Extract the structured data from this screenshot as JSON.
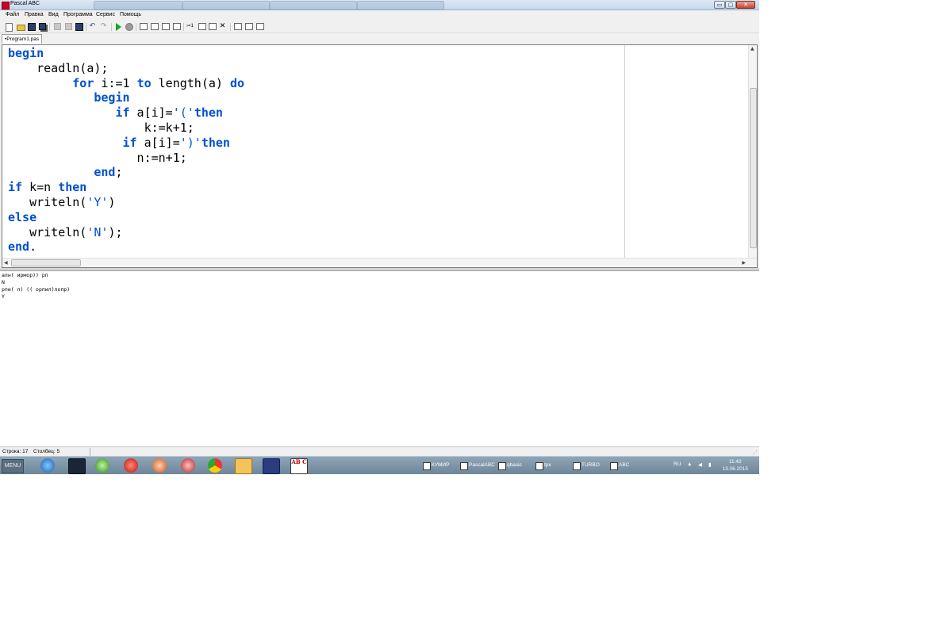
{
  "window": {
    "title": "Pascal ABC",
    "minimize": "▭",
    "maximize": "▢",
    "close": "✕"
  },
  "menu": [
    "Файл",
    "Правка",
    "Вид",
    "Программа",
    "Сервис",
    "Помощь"
  ],
  "toolbar": {
    "icons": [
      "new-file-icon",
      "open-folder-icon",
      "save-icon",
      "save-all-icon",
      "cut-icon",
      "copy-icon",
      "paste-icon",
      "undo-icon",
      "redo-icon",
      "run-icon",
      "stop-icon",
      "step-into-icon",
      "step-over-icon",
      "step-out-icon",
      "watch-icon",
      "tab-settings-icon",
      "window-icon",
      "compare-icon",
      "close-x-icon",
      "layout-icon",
      "layout2-icon",
      "layout3-icon"
    ],
    "undo": "↶",
    "redo": "↷",
    "step_text": "›=1",
    "close_x": "✕"
  },
  "editor_tab": "•Program1.pas",
  "code": [
    [
      {
        "t": "kw",
        "v": "begin"
      }
    ],
    [
      {
        "t": "p",
        "v": "    readln(a);"
      }
    ],
    [
      {
        "t": "p",
        "v": "         "
      },
      {
        "t": "kw",
        "v": "for"
      },
      {
        "t": "p",
        "v": " i:=1 "
      },
      {
        "t": "kw",
        "v": "to"
      },
      {
        "t": "p",
        "v": " length(a) "
      },
      {
        "t": "kw",
        "v": "do"
      }
    ],
    [
      {
        "t": "p",
        "v": "            "
      },
      {
        "t": "kw",
        "v": "begin"
      }
    ],
    [
      {
        "t": "p",
        "v": "               "
      },
      {
        "t": "kw",
        "v": "if"
      },
      {
        "t": "p",
        "v": " a[i]="
      },
      {
        "t": "str",
        "v": "'('"
      },
      {
        "t": "kw",
        "v": "then"
      }
    ],
    [
      {
        "t": "p",
        "v": "                   k:=k+1;"
      }
    ],
    [
      {
        "t": "p",
        "v": "                "
      },
      {
        "t": "kw",
        "v": "if"
      },
      {
        "t": "p",
        "v": " a[i]="
      },
      {
        "t": "str",
        "v": "')'"
      },
      {
        "t": "kw",
        "v": "then"
      }
    ],
    [
      {
        "t": "p",
        "v": "                  n:=n+1;"
      }
    ],
    [
      {
        "t": "p",
        "v": "            "
      },
      {
        "t": "kw",
        "v": "end"
      },
      {
        "t": "p",
        "v": ";"
      }
    ],
    [
      {
        "t": "kw",
        "v": "if"
      },
      {
        "t": "p",
        "v": " k=n "
      },
      {
        "t": "kw",
        "v": "then"
      }
    ],
    [
      {
        "t": "p",
        "v": "   writeln("
      },
      {
        "t": "str",
        "v": "'Y'"
      },
      {
        "t": "p",
        "v": ")"
      }
    ],
    [
      {
        "t": "kw",
        "v": "else"
      }
    ],
    [
      {
        "t": "p",
        "v": "   writeln("
      },
      {
        "t": "str",
        "v": "'N'"
      },
      {
        "t": "p",
        "v": ");"
      }
    ],
    [
      {
        "t": "kw",
        "v": "end"
      },
      {
        "t": "p",
        "v": "."
      }
    ]
  ],
  "colors": {
    "keyword": "#0050d0",
    "plain": "#000000"
  },
  "output_lines": [
    "алн( ирмор)) рп",
    "N",
    "рпи( л) (( орпил)лопр)",
    "Y"
  ],
  "status": {
    "line": "Строка: 17",
    "column": "Столбец: 5"
  },
  "taskbar": {
    "start": "MENU",
    "pinned_icons": [
      "ie-icon",
      "terminal-icon",
      "network-icon",
      "opera-icon",
      "gear-icon",
      "globe-icon",
      "chrome-icon",
      "media-player-icon",
      "floppy-icon",
      "abc-icon"
    ],
    "abc_icon_text": "AB C",
    "tasks": [
      "КУМИР",
      "PascalABC",
      "qbasic",
      "tpx",
      "TURBO",
      "ABC"
    ],
    "lang": "RU",
    "time": "11:42",
    "date": "13.06.2015"
  }
}
